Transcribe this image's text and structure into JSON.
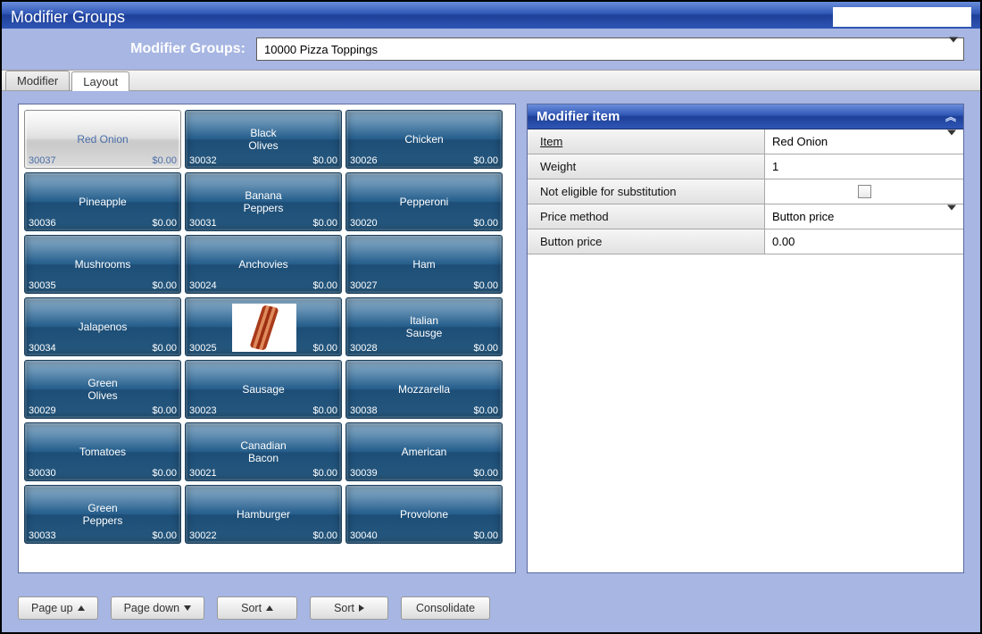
{
  "title": "Modifier Groups",
  "selector": {
    "label": "Modifier Groups:",
    "value": "10000 Pizza Toppings"
  },
  "tabs": [
    {
      "label": "Modifier",
      "active": false
    },
    {
      "label": "Layout",
      "active": true
    }
  ],
  "grid": {
    "items": [
      {
        "id": "30037",
        "label": "Red Onion",
        "price": "$0.00",
        "selected": true
      },
      {
        "id": "30032",
        "label": "Black\nOlives",
        "price": "$0.00"
      },
      {
        "id": "30026",
        "label": "Chicken",
        "price": "$0.00"
      },
      {
        "id": "30036",
        "label": "Pineapple",
        "price": "$0.00"
      },
      {
        "id": "30031",
        "label": "Banana\nPeppers",
        "price": "$0.00"
      },
      {
        "id": "30020",
        "label": "Pepperoni",
        "price": "$0.00"
      },
      {
        "id": "30035",
        "label": "Mushrooms",
        "price": "$0.00"
      },
      {
        "id": "30024",
        "label": "Anchovies",
        "price": "$0.00"
      },
      {
        "id": "30027",
        "label": "Ham",
        "price": "$0.00"
      },
      {
        "id": "30034",
        "label": "Jalapenos",
        "price": "$0.00"
      },
      {
        "id": "30025",
        "label": "",
        "price": "$0.00",
        "image": "bacon"
      },
      {
        "id": "30028",
        "label": "Italian\nSausge",
        "price": "$0.00"
      },
      {
        "id": "30029",
        "label": "Green\nOlives",
        "price": "$0.00"
      },
      {
        "id": "30023",
        "label": "Sausage",
        "price": "$0.00"
      },
      {
        "id": "30038",
        "label": "Mozzarella",
        "price": "$0.00"
      },
      {
        "id": "30030",
        "label": "Tomatoes",
        "price": "$0.00"
      },
      {
        "id": "30021",
        "label": "Canadian\nBacon",
        "price": "$0.00"
      },
      {
        "id": "30039",
        "label": "American",
        "price": "$0.00"
      },
      {
        "id": "30033",
        "label": "Green\nPeppers",
        "price": "$0.00"
      },
      {
        "id": "30022",
        "label": "Hamburger",
        "price": "$0.00"
      },
      {
        "id": "30040",
        "label": "Provolone",
        "price": "$0.00"
      }
    ]
  },
  "modifier_item": {
    "title": "Modifier item",
    "rows": {
      "item_label": "Item",
      "item_value": "Red Onion",
      "weight_label": "Weight",
      "weight_value": "1",
      "not_eligible_label": "Not eligible for substitution",
      "price_method_label": "Price method",
      "price_method_value": "Button price",
      "button_price_label": "Button price",
      "button_price_value": "0.00"
    }
  },
  "buttons": {
    "page_up": "Page up",
    "page_down": "Page down",
    "sort_up": "Sort",
    "sort_right": "Sort",
    "consolidate": "Consolidate"
  }
}
